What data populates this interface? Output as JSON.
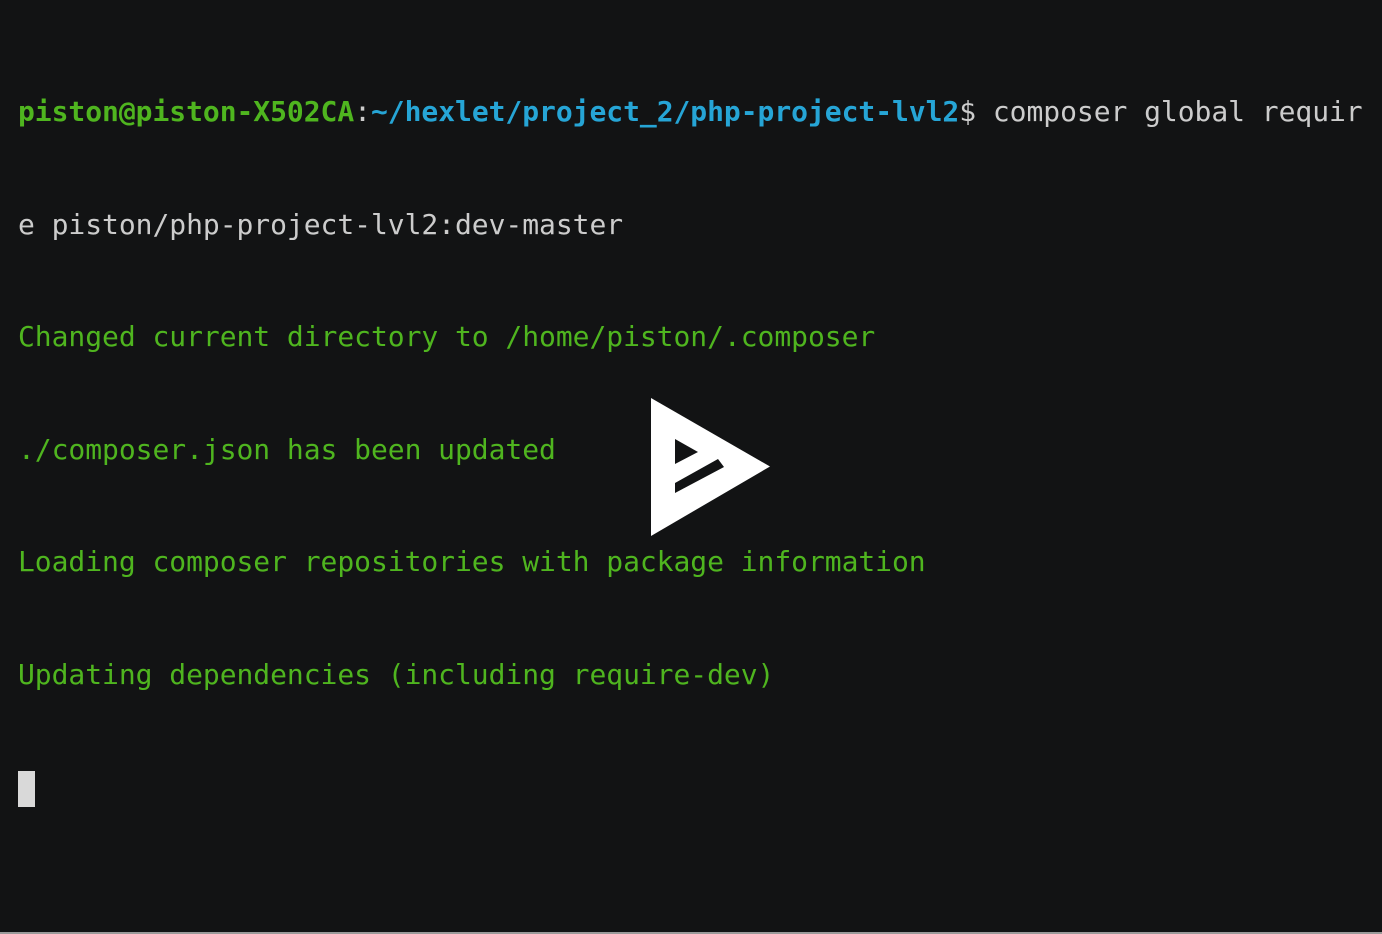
{
  "terminal": {
    "prompt": {
      "user_host": "piston@piston-X502CA",
      "separator": ":",
      "path": "~/hexlet/project_2/php-project-lvl2",
      "symbol": "$",
      "command_line1": " composer global requir",
      "command_line2": "e piston/php-project-lvl2:dev-master"
    },
    "output": [
      "Changed current directory to /home/piston/.composer",
      "./composer.json has been updated",
      "Loading composer repositories with package information",
      "Updating dependencies (including require-dev)"
    ],
    "colors": {
      "background": "#121314",
      "user_host": "#4fb51f",
      "path": "#26a5d6",
      "foreground": "#cccccc",
      "output": "#4fb51f",
      "cursor": "#d9d9d9"
    }
  },
  "player": {
    "play_icon": "asciinema-play-icon"
  }
}
